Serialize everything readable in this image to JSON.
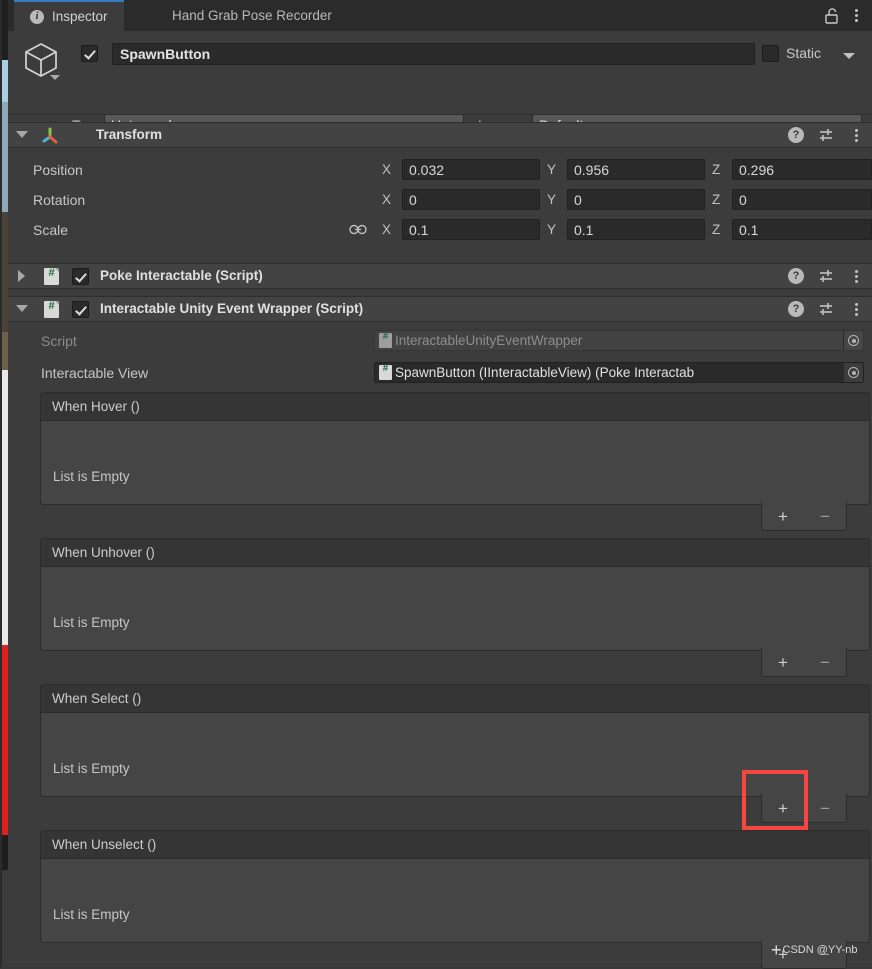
{
  "window": {
    "tabs": [
      {
        "label": "Inspector",
        "icon": "info-icon",
        "active": true
      },
      {
        "label": "Hand Grab Pose Recorder",
        "active": false
      }
    ],
    "lock_icon": "lock-open-icon",
    "menu_icon": "kebab-menu-icon"
  },
  "gameobject": {
    "icon": "cube-icon",
    "enabled": true,
    "name": "SpawnButton",
    "static_label": "Static",
    "static_checked": false,
    "tag_label": "Tag",
    "tag_value": "Untagged",
    "layer_label": "Layer",
    "layer_value": "Default"
  },
  "transform": {
    "title": "Transform",
    "expanded": true,
    "icon": "transform-axis-icon",
    "help_icon": "help-icon",
    "preset_icon": "preset-sliders-icon",
    "menu_icon": "kebab-menu-icon",
    "link_icon": "constrain-proportions-link-icon",
    "rows": [
      {
        "label": "Position",
        "x": "0.032",
        "y": "0.956",
        "z": "0.296",
        "linked": false
      },
      {
        "label": "Rotation",
        "x": "0",
        "y": "0",
        "z": "0",
        "linked": false
      },
      {
        "label": "Scale",
        "x": "0.1",
        "y": "0.1",
        "z": "0.1",
        "linked": true
      }
    ],
    "axis_labels": {
      "x": "X",
      "y": "Y",
      "z": "Z"
    }
  },
  "components": [
    {
      "title": "Poke Interactable (Script)",
      "expanded": false,
      "enabled": true,
      "icon": "script-icon"
    },
    {
      "title": "Interactable Unity Event Wrapper (Script)",
      "expanded": true,
      "enabled": true,
      "icon": "script-icon"
    }
  ],
  "wrapper": {
    "script_label": "Script",
    "script_value": "InteractableUnityEventWrapper",
    "interactable_view_label": "Interactable View",
    "interactable_view_value": "SpawnButton (IInteractableView) (Poke Interactab",
    "picker_icon": "object-picker-icon",
    "events": [
      {
        "title": "When Hover ()",
        "empty_text": "List is Empty",
        "add_label": "+",
        "remove_label": "−",
        "highlighted": false
      },
      {
        "title": "When Unhover ()",
        "empty_text": "List is Empty",
        "add_label": "+",
        "remove_label": "−",
        "highlighted": false
      },
      {
        "title": "When Select ()",
        "empty_text": "List is Empty",
        "add_label": "+",
        "remove_label": "−",
        "highlighted": true
      },
      {
        "title": "When Unselect ()",
        "empty_text": "List is Empty",
        "add_label": "+",
        "remove_label": "−",
        "highlighted": false
      }
    ]
  },
  "annotation": {
    "color": "#f5473f",
    "target": "add-listener-button-when-select"
  },
  "watermark": {
    "text": "CSDN @YY-nb"
  },
  "colors": {
    "panel_bg": "#3c3c3c",
    "tabbar_bg": "#2b2b2b",
    "active_tab_accent": "#3a79c4",
    "field_bg": "#2a2a2a",
    "dropdown_bg": "#585858",
    "event_body_bg": "#454545",
    "component_header_bg": "#434343",
    "annotation_red": "#f5473f"
  }
}
